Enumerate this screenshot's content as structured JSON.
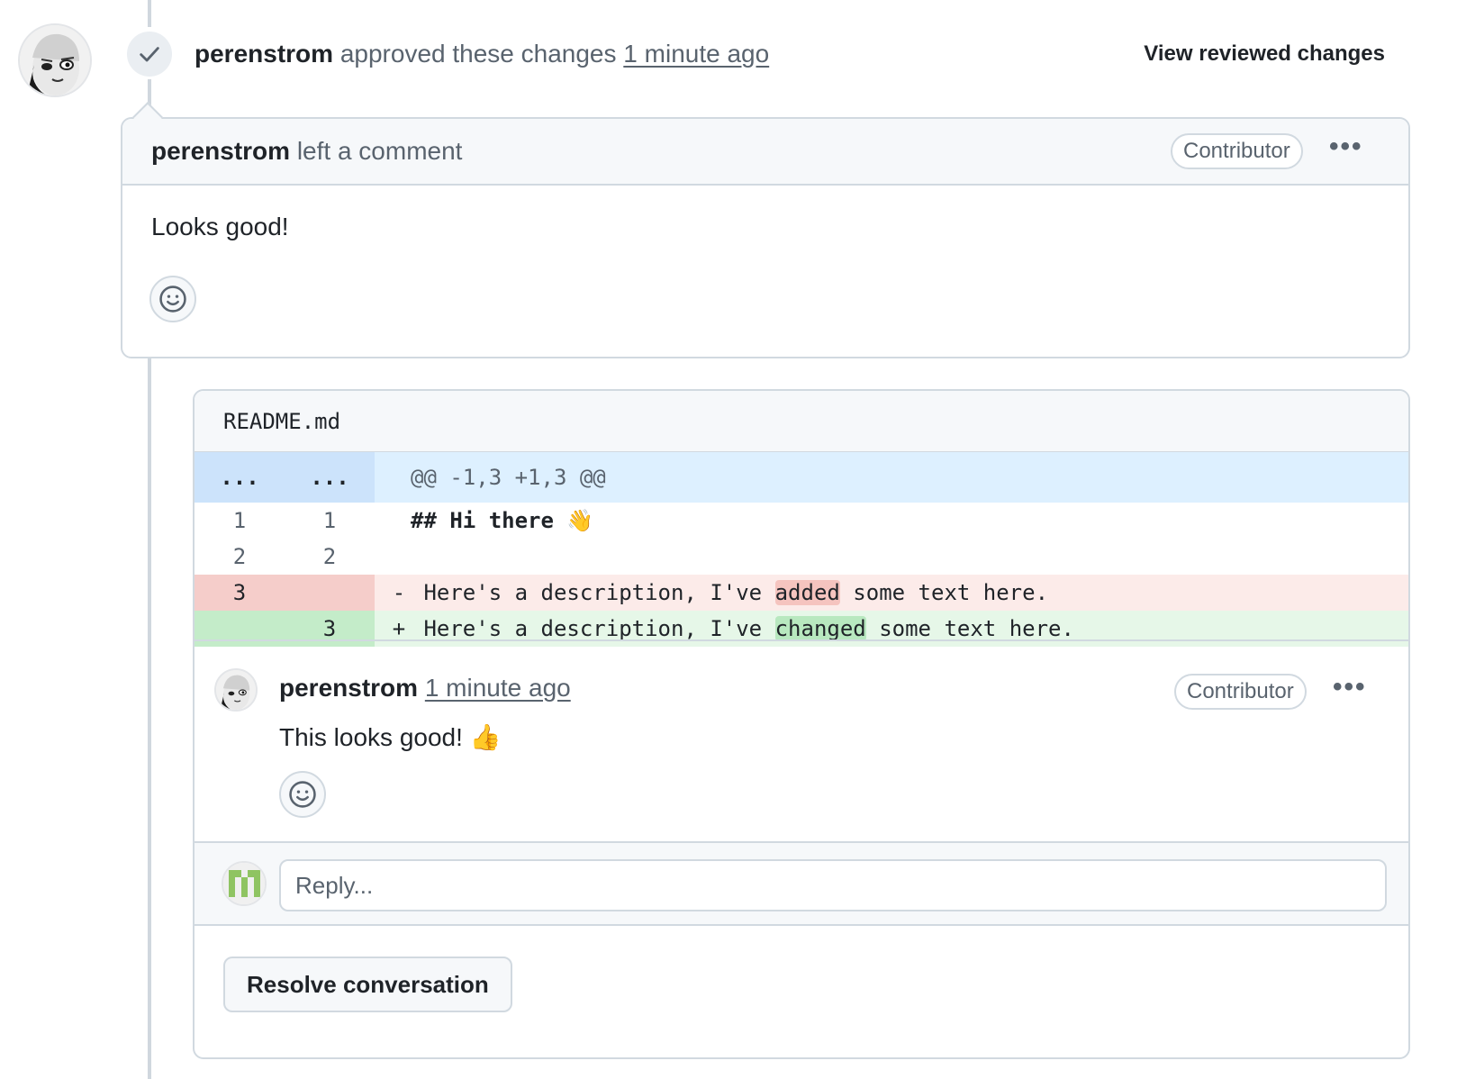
{
  "review": {
    "author": "perenstrom",
    "action": "approved these changes",
    "time": "1 minute ago",
    "view_link": "View reviewed changes"
  },
  "comment": {
    "author": "perenstrom",
    "action": "left a comment",
    "badge": "Contributor",
    "menu": "•••",
    "body": "Looks good!"
  },
  "file": {
    "name": "README.md",
    "hunk": {
      "left": "...",
      "right": "...",
      "header": "@@ -1,3 +1,3 @@"
    },
    "lines": [
      {
        "type": "context",
        "old": "1",
        "new": "1",
        "prefix": "",
        "text": "## Hi there 👋"
      },
      {
        "type": "context",
        "old": "2",
        "new": "2",
        "prefix": "",
        "text": ""
      },
      {
        "type": "deletion",
        "old": "3",
        "new": "",
        "sign": "-",
        "before": "Here's a description, I've ",
        "highlight": "added",
        "after": " some text here."
      },
      {
        "type": "addition",
        "old": "",
        "new": "3",
        "sign": "+",
        "before": "Here's a description, I've ",
        "highlight": "changed",
        "after": " some text here."
      }
    ]
  },
  "thread_comment": {
    "author": "perenstrom",
    "time": "1 minute ago",
    "badge": "Contributor",
    "menu": "•••",
    "body": "This looks good! 👍"
  },
  "reply": {
    "placeholder": "Reply..."
  },
  "resolve": {
    "label": "Resolve conversation"
  },
  "colors": {
    "border": "#d1d9e0",
    "header_bg": "#f6f8fa",
    "hunk_bg": "#ddf0ff",
    "deletion_bg": "#fcebe9",
    "addition_bg": "#e6f7e8",
    "md_heading": "#0e3ca5"
  }
}
